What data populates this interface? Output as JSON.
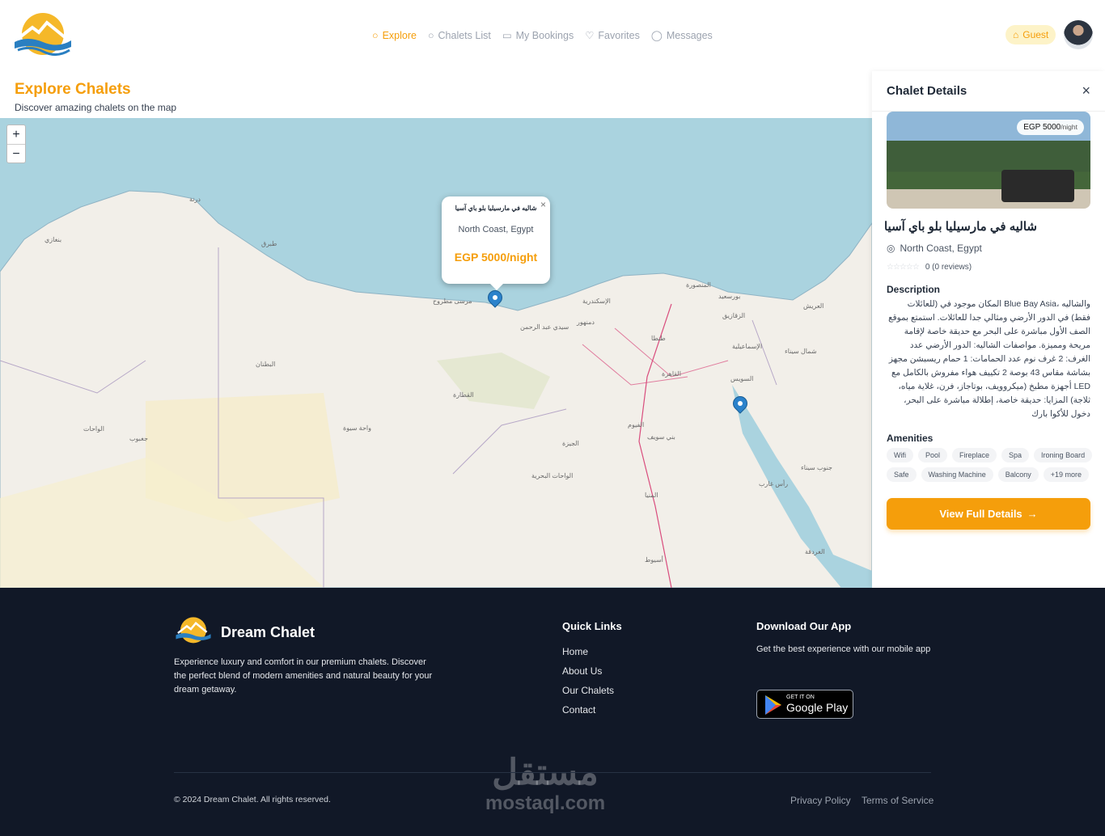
{
  "header": {
    "nav": [
      {
        "label": "Explore",
        "icon": "search-icon"
      },
      {
        "label": "Chalets List",
        "icon": "search-icon"
      },
      {
        "label": "My Bookings",
        "icon": "calendar-icon"
      },
      {
        "label": "Favorites",
        "icon": "heart-icon"
      },
      {
        "label": "Messages",
        "icon": "chat-icon"
      }
    ],
    "guest_label": "Guest"
  },
  "page": {
    "title": "Explore Chalets",
    "subtitle": "Discover amazing chalets on the map"
  },
  "map": {
    "zoom_in": "+",
    "zoom_out": "−",
    "labels": [
      "الإسكندرية",
      "القاهرة",
      "مرسى مطروح",
      "سيدي عبد الرحمن",
      "طنطا",
      "بورسعيد",
      "الإسماعيلية",
      "السويس",
      "الجيزة",
      "الفيوم",
      "بني سويف",
      "المنيا",
      "أسيوط",
      "الغردقة",
      "واحة سيوة",
      "الواحات البحرية",
      "بنغازي",
      "طبرق",
      "درنة",
      "شمال سيناء",
      "جنوب سيناء",
      "العريش",
      "المنصورة",
      "الزقازيق",
      "دمنهور",
      "رأس غارب",
      "القطارة",
      "جغبوب",
      "البطنان",
      "الواحات"
    ],
    "popup": {
      "title": "شاليه في مارسيليا بلو باي آسيا",
      "location": "North Coast, Egypt",
      "price": "EGP 5000/night",
      "close": "×"
    }
  },
  "panel": {
    "title": "Chalet Details",
    "close": "×",
    "price_badge": "EGP 5000",
    "price_unit": "/night",
    "chalet_title": "شاليه في مارسيليا بلو باي آسيا",
    "location": "North Coast, Egypt",
    "rating": "0 (0 reviews)",
    "stars": "☆☆☆☆☆",
    "description_heading": "Description",
    "description": "والشاليه ،Blue Bay Asia المكان موجود في (للعائلات فقط) في الدور الأرضي ومثالي جدا للعائلات. استمتع بموقع الصف الأول مباشرة على البحر مع حديقة خاصة لإقامة مريحة ومميزة. مواصفات الشاليه: الدور الأرضي عدد الغرف: 2 غرف نوم عدد الحمامات: 1 حمام ريسبشن مجهز بشاشة مقاس 43 بوصة 2 تكييف هواء مفروش بالكامل مع LED أجهزة مطبخ (ميكروويف، بوتاجاز، فرن، غلاية مياه، ثلاجة) المزايا: حديقة خاصة، إطلالة مباشرة على البحر، دخول للأكوا بارك",
    "amenities_heading": "Amenities",
    "amenities": [
      "Wifi",
      "Pool",
      "Fireplace",
      "Spa",
      "Ironing Board",
      "Safe",
      "Washing Machine",
      "Balcony",
      "+19 more"
    ],
    "cta": "View Full Details",
    "cta_icon": "→"
  },
  "footer": {
    "brand": "Dream Chalet",
    "description": "Experience luxury and comfort in our premium chalets. Discover the perfect blend of modern amenities and natural beauty for your dream getaway.",
    "quick_links_heading": "Quick Links",
    "quick_links": [
      "Home",
      "About Us",
      "Our Chalets",
      "Contact"
    ],
    "app_heading": "Download Our App",
    "app_text": "Get the best experience with our mobile app",
    "gplay_small": "GET IT ON",
    "gplay_big": "Google Play",
    "copyright": "© 2024 Dream Chalet. All rights reserved.",
    "privacy": "Privacy Policy",
    "terms": "Terms of Service",
    "watermark_ar": "مستقل",
    "watermark_en": "mostaql.com"
  },
  "colors": {
    "accent": "#f59e0b",
    "footer_bg": "#111827",
    "sea": "#aad3df",
    "land": "#f2efe9"
  }
}
